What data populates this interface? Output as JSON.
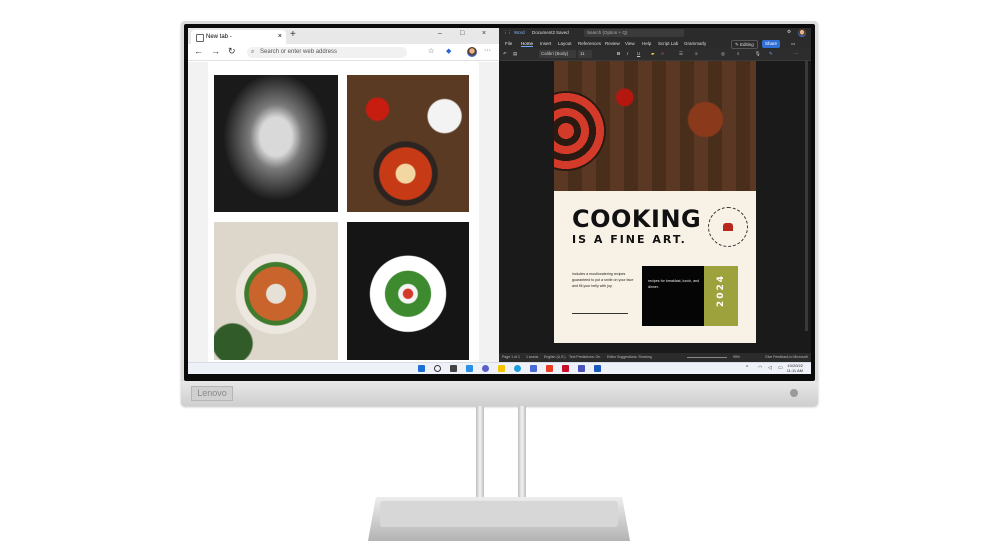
{
  "browser": {
    "tab_title": "New tab",
    "tab_separator": "-",
    "close_tab": "×",
    "new_tab": "+",
    "window_controls": [
      "–",
      "□",
      "×"
    ],
    "address_placeholder": "Search or enter web address",
    "back": "←",
    "forward": "→",
    "refresh": "↻",
    "more": "···"
  },
  "word": {
    "app_name": "Word",
    "document": "Document2",
    "saved": "Saved",
    "search_placeholder": "Search (Option + Q)",
    "ribbon_tabs": [
      "File",
      "Home",
      "Insert",
      "Layout",
      "References",
      "Review",
      "View",
      "Help",
      "Script Lab",
      "Grammarly"
    ],
    "editing": "Editing",
    "share": "Share",
    "font_name": "Calibri (Body)",
    "font_size": "11",
    "status_items": [
      "Page 1 of 1",
      "1 words",
      "English (U.S.)",
      "Text Predictions: On",
      "Editor Suggestions: Showing"
    ],
    "zoom": "95%",
    "feedback": "Give Feedback to Microsoft"
  },
  "document": {
    "title": "COOKING",
    "subtitle": "IS A FINE ART.",
    "body": "includes a mouthwatering recipes guaranteed to put a smile on your face and fill your belly with joy.",
    "box_text": "recipes for breakfast, lunch, and dinner.",
    "year": "2024",
    "seal_text": "YOUR FAVORITE COOK BOOK"
  },
  "taskbar": {
    "date": "10/20/22",
    "time": "11:11 AM"
  },
  "monitor": {
    "brand": "Lenovo"
  }
}
